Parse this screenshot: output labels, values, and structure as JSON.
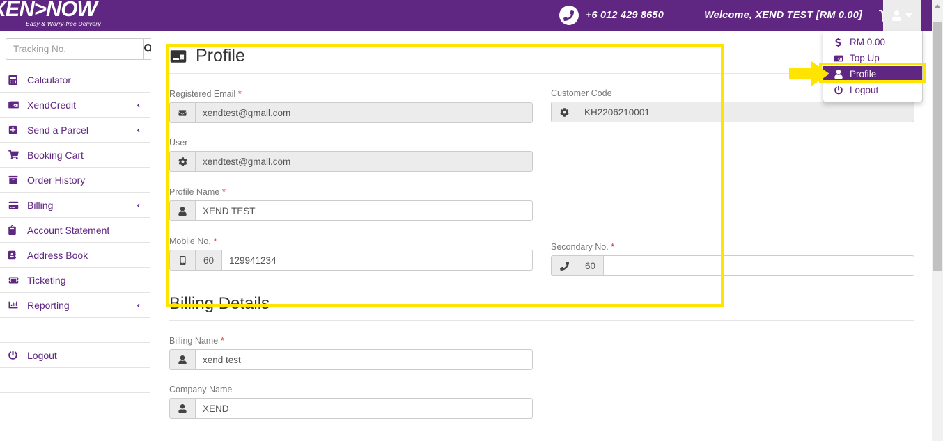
{
  "brand": {
    "name": "XEN>NOW",
    "tagline": "Easy & Worry-free Delivery"
  },
  "header": {
    "phone": "+6 012 429 8650",
    "welcome_prefix": "Welcome,",
    "welcome_user": "XEND TEST [RM 0.00]",
    "cart_icon": "shopping-cart-icon",
    "user_icon": "user-icon",
    "caret_icon": "caret-down-icon",
    "accent_purple": "#5f2682",
    "highlight_yellow": "#ffe400"
  },
  "user_dropdown": {
    "items": [
      {
        "label": "RM 0.00",
        "icon": "dollar-icon",
        "active": false
      },
      {
        "label": "Top Up",
        "icon": "wallet-icon",
        "active": false
      },
      {
        "label": "Profile",
        "icon": "user-icon",
        "active": true
      },
      {
        "label": "Logout",
        "icon": "power-off-icon",
        "active": false
      }
    ]
  },
  "sidebar": {
    "search": {
      "placeholder": "Tracking No.",
      "value": "",
      "button_icon": "search-icon"
    },
    "items": [
      {
        "label": "Calculator",
        "icon": "calculator-icon",
        "chevron": ""
      },
      {
        "label": "XendCredit",
        "icon": "wallet-icon",
        "chevron": "‹"
      },
      {
        "label": "Send a Parcel",
        "icon": "plus-square-icon",
        "chevron": "‹"
      },
      {
        "label": "Booking Cart",
        "icon": "cart-icon",
        "chevron": ""
      },
      {
        "label": "Order History",
        "icon": "archive-icon",
        "chevron": ""
      },
      {
        "label": "Billing",
        "icon": "credit-card-icon",
        "chevron": "‹"
      },
      {
        "label": "Account Statement",
        "icon": "clipboard-icon",
        "chevron": ""
      },
      {
        "label": "Address Book",
        "icon": "address-book-icon",
        "chevron": ""
      },
      {
        "label": "Ticketing",
        "icon": "ticket-icon",
        "chevron": ""
      },
      {
        "label": "Reporting",
        "icon": "bar-chart-icon",
        "chevron": "‹"
      }
    ],
    "logout": {
      "label": "Logout",
      "icon": "power-off-icon"
    }
  },
  "profile_panel": {
    "title": "Profile",
    "title_icon": "id-card-icon",
    "fields": {
      "registered_email": {
        "label": "Registered Email",
        "required": true,
        "icon": "envelope-icon",
        "value": "xendtest@gmail.com",
        "disabled": true
      },
      "customer_code": {
        "label": "Customer Code",
        "required": false,
        "icon": "gear-icon",
        "value": "KH2206210001",
        "disabled": true
      },
      "user": {
        "label": "User",
        "required": false,
        "icon": "gear-icon",
        "value": "xendtest@gmail.com",
        "disabled": true
      },
      "profile_name": {
        "label": "Profile Name",
        "required": true,
        "icon": "user-icon",
        "value": "XEND TEST",
        "disabled": false
      },
      "mobile_no": {
        "label": "Mobile No.",
        "required": true,
        "icon": "mobile-icon",
        "country_code": "60",
        "value": "129941234",
        "disabled": false
      },
      "secondary_no": {
        "label": "Secondary No.",
        "required": true,
        "icon": "phone-icon",
        "country_code": "60",
        "value": "",
        "disabled": false
      }
    }
  },
  "billing_panel": {
    "title": "Billing Details",
    "fields": {
      "billing_name": {
        "label": "Billing Name",
        "required": true,
        "icon": "user-icon",
        "value": "xend test"
      },
      "company_name": {
        "label": "Company Name",
        "required": false,
        "icon": "user-icon",
        "value": "XEND"
      }
    }
  },
  "annotations": {
    "panel_box_color": "#ffe400",
    "menu_box_color": "#ffe400",
    "arrow_icon": "right-arrow-annotation"
  }
}
